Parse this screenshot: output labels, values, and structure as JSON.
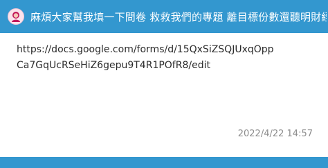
{
  "header": {
    "avatar_icon": "female-avatar-icon",
    "title": "麻煩大家幫我填一下問卷 救救我們的專題 離目標份數還聽明財經科大"
  },
  "post": {
    "line1": "https://docs.google.com/forms/d/15QxSiZSQJUxqOpp",
    "line2": "Ca7GqUcRSeHiZ6gepu9T4R1POfR8/edit",
    "timestamp": "2022/4/22 14:57"
  },
  "colors": {
    "brand": "#3397cf",
    "text": "#2b2b2b",
    "muted": "#8c8c8c"
  }
}
